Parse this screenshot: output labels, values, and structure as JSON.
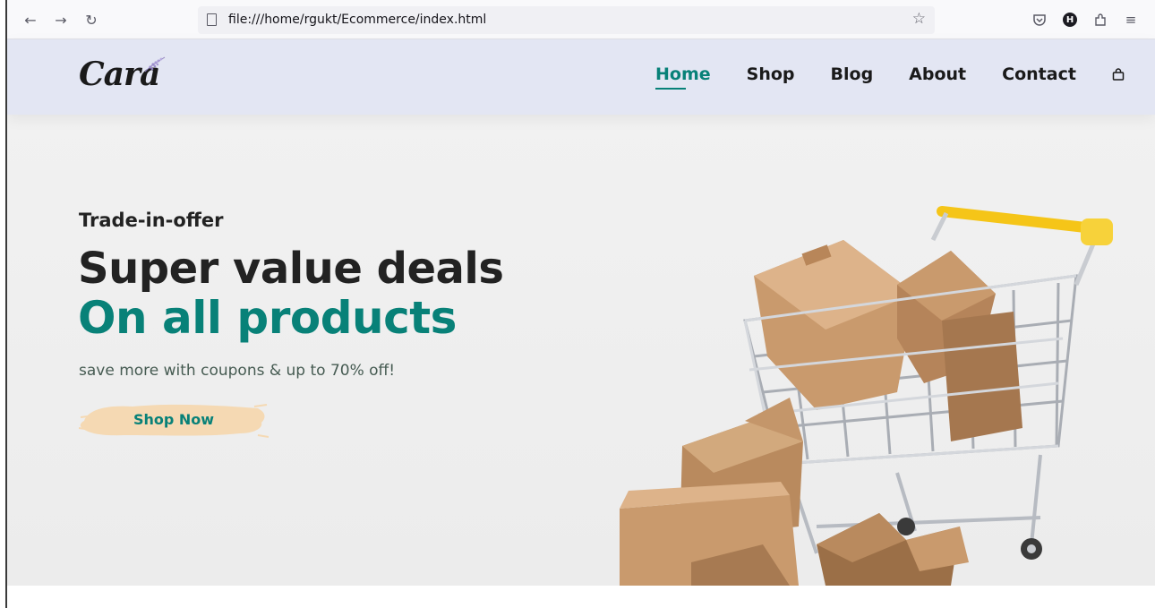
{
  "browser": {
    "url": "file:///home/rgukt/Ecommerce/index.html",
    "profile_initial": "H",
    "icons": [
      "back-arrow-icon",
      "forward-arrow-icon",
      "reload-icon",
      "page-icon",
      "bookmark-star-icon",
      "pocket-icon",
      "account-avatar-icon",
      "extensions-icon",
      "menu-icon"
    ]
  },
  "site": {
    "logo": "Cara",
    "nav": [
      {
        "label": "Home",
        "active": true
      },
      {
        "label": "Shop",
        "active": false
      },
      {
        "label": "Blog",
        "active": false
      },
      {
        "label": "About",
        "active": false
      },
      {
        "label": "Contact",
        "active": false
      }
    ],
    "cart_icon": "shopping-bag-icon"
  },
  "hero": {
    "subtitle": "Trade-in-offer",
    "title_line1": "Super value deals",
    "title_line2": "On all products",
    "text": "save more with coupons & up to 70% off!",
    "button_label": "Shop Now",
    "image": "shopping-cart-with-boxes"
  },
  "colors": {
    "accent": "#088178",
    "header_bg": "#e3e6f3",
    "button_brush": "#f5d9b3",
    "cart_handle": "#f5c518"
  }
}
